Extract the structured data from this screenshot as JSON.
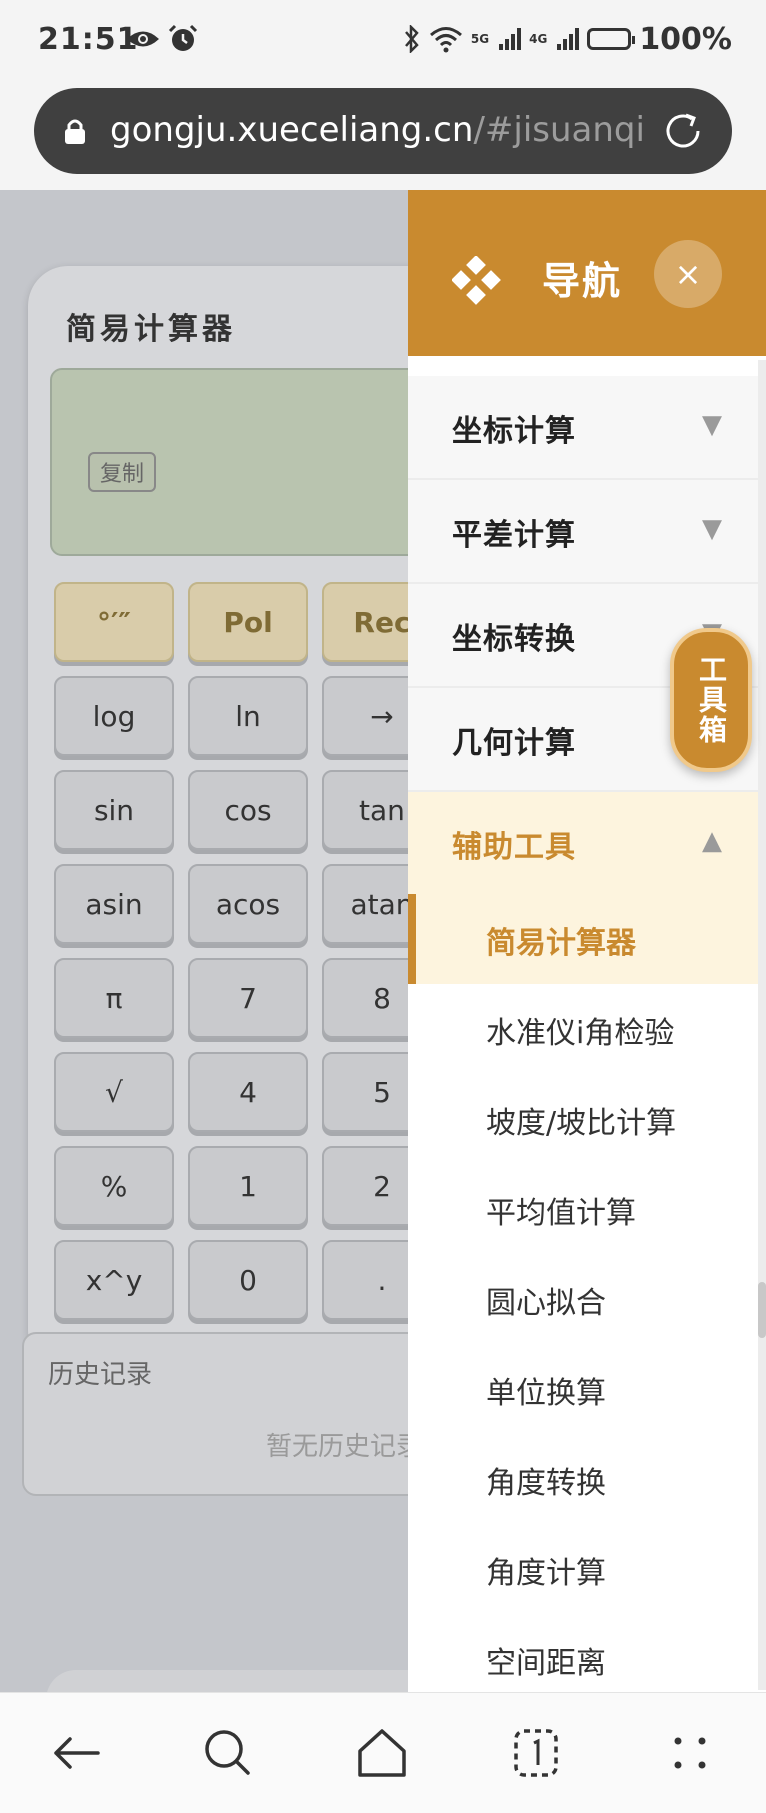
{
  "status_bar": {
    "time": "21:51",
    "battery": "100%",
    "net_5g": "5G",
    "net_4g": "4G"
  },
  "browser": {
    "url_main": "gongju.xueceliang.cn",
    "url_hash": "/#jisuanqi"
  },
  "calculator": {
    "title": "简易计算器",
    "copy_label": "复制",
    "keys": [
      [
        "°′″",
        "Pol",
        "Rec"
      ],
      [
        "log",
        "ln",
        "→"
      ],
      [
        "sin",
        "cos",
        "tan"
      ],
      [
        "asin",
        "acos",
        "atan"
      ],
      [
        "π",
        "7",
        "8"
      ],
      [
        "√",
        "4",
        "5"
      ],
      [
        "%",
        "1",
        "2"
      ],
      [
        "x^y",
        "0",
        "."
      ]
    ],
    "history_title": "历史记录",
    "history_empty": "暂无历史记录"
  },
  "drawer": {
    "title": "导航",
    "close_label": "×",
    "categories": [
      {
        "label": "坐标计算",
        "arrow": "▼"
      },
      {
        "label": "平差计算",
        "arrow": "▼"
      },
      {
        "label": "坐标转换",
        "arrow": "▼"
      },
      {
        "label": "几何计算",
        "arrow": "▼"
      },
      {
        "label": "辅助工具",
        "arrow": "▲"
      }
    ],
    "sub_items": [
      "简易计算器",
      "水准仪i角检验",
      "坡度/坡比计算",
      "平均值计算",
      "圆心拟合",
      "单位换算",
      "角度转换",
      "角度计算",
      "空间距离"
    ]
  },
  "toolbox": {
    "label": "工具箱"
  },
  "colors": {
    "accent": "#c98a2f",
    "accent_light": "#fdf4de",
    "display": "#b9c4af"
  },
  "icons": [
    "eye-icon",
    "alarm-icon",
    "bluetooth-icon",
    "wifi-icon",
    "lock-icon",
    "reload-icon",
    "diamond-logo-icon",
    "back-icon",
    "search-icon",
    "home-icon",
    "tabs-icon",
    "menu-icon"
  ]
}
